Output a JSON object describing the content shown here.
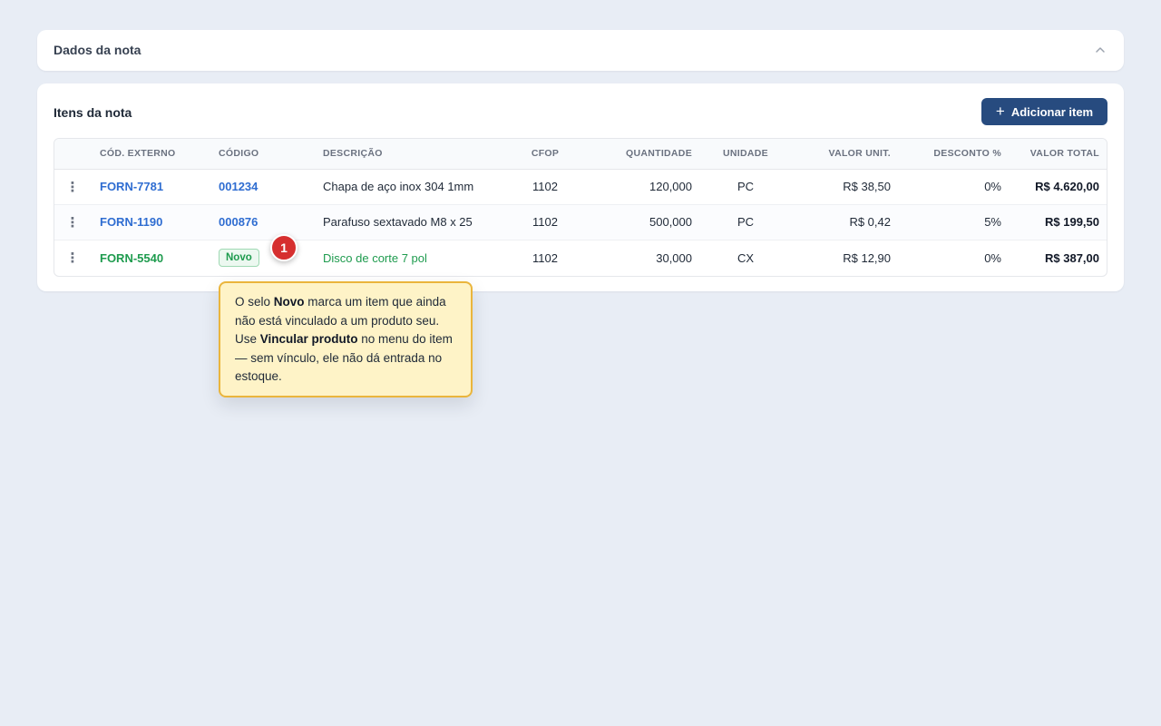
{
  "dados_card": {
    "title": "Dados da nota",
    "toggle_icon": "chevron-up-icon"
  },
  "itens_card": {
    "title": "Itens da nota",
    "add_button": {
      "icon": "plus-icon",
      "label": "Adicionar item"
    },
    "columns": {
      "cod_externo": "CÓD. EXTERNO",
      "codigo": "CÓDIGO",
      "descricao": "DESCRIÇÃO",
      "cfop": "CFOP",
      "quantidade": "QUANTIDADE",
      "unidade": "UNIDADE",
      "valor_unit": "VALOR UNIT.",
      "desconto": "DESCONTO %",
      "valor_total": "VALOR TOTAL"
    },
    "rows": [
      {
        "menu_icon": "kebab-menu-icon",
        "cod_externo": "FORN-7781",
        "codigo": "001234",
        "descricao": "Chapa de aço inox 304 1mm",
        "cfop": "1102",
        "quantidade": "120,000",
        "unidade": "PC",
        "valor_unit": "R$ 38,50",
        "desconto": "0%",
        "valor_total": "R$ 4.620,00"
      },
      {
        "menu_icon": "kebab-menu-icon",
        "cod_externo": "FORN-1190",
        "codigo": "000876",
        "descricao": "Parafuso sextavado M8 x 25",
        "cfop": "1102",
        "quantidade": "500,000",
        "unidade": "PC",
        "valor_unit": "R$ 0,42",
        "desconto": "5%",
        "valor_total": "R$ 199,50"
      },
      {
        "menu_icon": "kebab-menu-icon",
        "cod_externo": "FORN-5540",
        "codigo_badge": "Novo",
        "descricao": "Disco de corte 7 pol",
        "cfop": "1102",
        "quantidade": "30,000",
        "unidade": "CX",
        "valor_unit": "R$ 12,90",
        "desconto": "0%",
        "valor_total": "R$ 387,00"
      }
    ]
  },
  "tour": {
    "step_number": "1",
    "tooltip": {
      "t1": "O selo ",
      "b1": "Novo",
      "t2": " marca um item que ainda não está vinculado a um produto seu. Use ",
      "b2": "Vincular produto",
      "t3": " no menu do item — sem vínculo, ele não dá entrada no estoque."
    }
  },
  "colors": {
    "background": "#e8edf5",
    "primary_button": "#274b7f",
    "link_blue": "#2f6dd1",
    "new_green": "#1e9b4e",
    "marker_red": "#d62f2f",
    "tooltip_bg": "#fef3c7",
    "tooltip_border": "#eab53c"
  }
}
